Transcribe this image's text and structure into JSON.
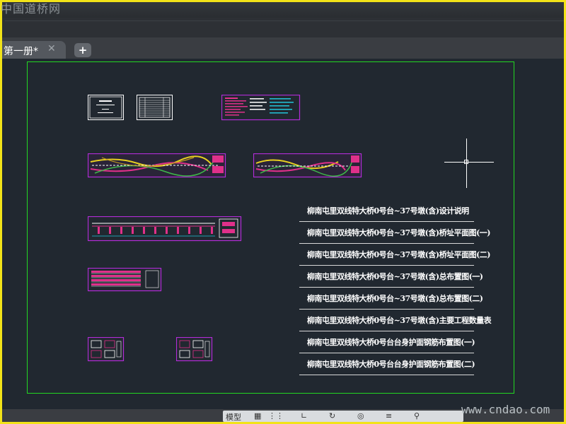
{
  "watermark_top": "中国道桥网",
  "watermark_bottom": "www.cndao.com",
  "tabs": {
    "active_label": "第一册*",
    "close_glyph": "✕",
    "new_glyph": "+"
  },
  "colors": {
    "frame": "#f2e318",
    "canvas": "#212830",
    "layout_border": "#22d822",
    "sheet_outline": "#b22cd8",
    "drawing_magenta": "#e0308a",
    "drawing_cyan": "#22c4d8"
  },
  "sheet_list": [
    "柳南屯里双线特大桥0号台~37号墩(含)设计说明",
    "柳南屯里双线特大桥0号台~37号墩(含)桥址平面图(一)",
    "柳南屯里双线特大桥0号台~37号墩(含)桥址平面图(二)",
    "柳南屯里双线特大桥0号台~37号墩(含)总布置图(一)",
    "柳南屯里双线特大桥0号台~37号墩(含)总布置图(二)",
    "柳南屯里双线特大桥0号台~37号墩(含)主要工程数量表",
    "柳南屯里双线特大桥0号台台身护面钢筋布置图(一)",
    "柳南屯里双线特大桥0号台台身护面钢筋布置图(二)"
  ],
  "status": {
    "model_label": "模型"
  }
}
